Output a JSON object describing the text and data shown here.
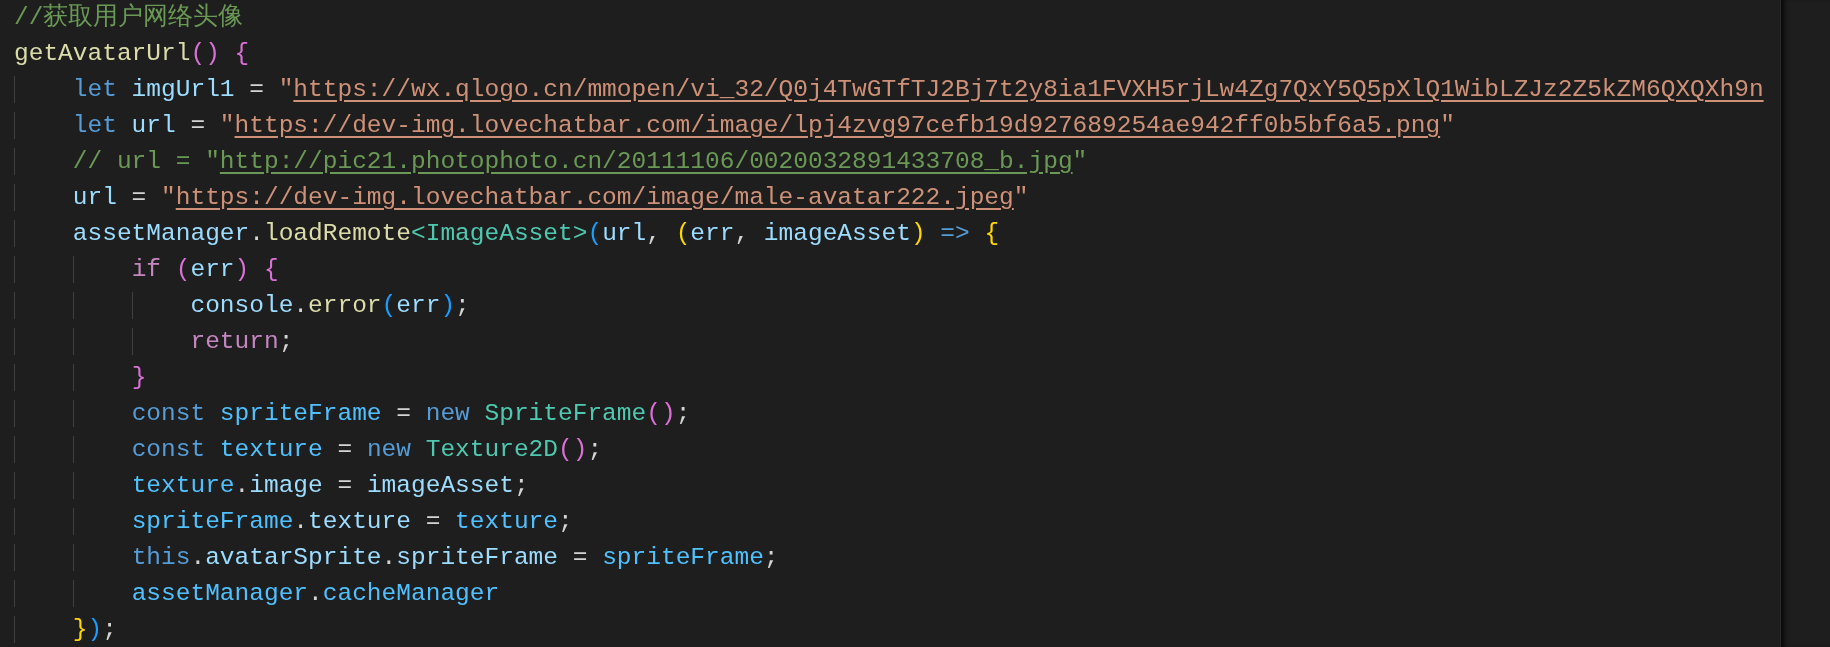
{
  "editor": {
    "lines": [
      {
        "tokens": [
          {
            "text": "//获取用户网络头像",
            "kind": "comment"
          }
        ]
      },
      {
        "tokens": [
          {
            "text": "getAvatarUrl",
            "kind": "function"
          },
          {
            "text": "()",
            "kind": "bracket2"
          },
          {
            "text": " {",
            "kind": "bracket2"
          }
        ]
      },
      {
        "tokens": [
          {
            "text": "    let",
            "kind": "keyword"
          },
          {
            "text": " imgUrl1",
            "kind": "variable"
          },
          {
            "text": " = ",
            "kind": "plain"
          },
          {
            "text": "\"",
            "kind": "string"
          },
          {
            "text": "https://wx.qlogo.cn/mmopen/vi_32/Q0j4TwGTfTJ2Bj7t2y8ia1FVXH5rjLw4Zg7QxY5Q5pXlQ1WibLZJz2Z5kZM6QXQXh9n",
            "kind": "string_link"
          }
        ]
      },
      {
        "tokens": [
          {
            "text": "    let",
            "kind": "keyword"
          },
          {
            "text": " url",
            "kind": "variable"
          },
          {
            "text": " = ",
            "kind": "plain"
          },
          {
            "text": "\"",
            "kind": "string"
          },
          {
            "text": "https://dev-img.lovechatbar.com/image/lpj4zvg97cefb19d927689254ae942ff0b5bf6a5.png",
            "kind": "string_link"
          },
          {
            "text": "\"",
            "kind": "string"
          }
        ]
      },
      {
        "tokens": [
          {
            "text": "    // url = \"",
            "kind": "comment"
          },
          {
            "text": "http://pic21.photophoto.cn/20111106/0020032891433708_b.jpg",
            "kind": "comment_link"
          },
          {
            "text": "\"",
            "kind": "comment"
          }
        ]
      },
      {
        "tokens": [
          {
            "text": "    url",
            "kind": "variable"
          },
          {
            "text": " = ",
            "kind": "plain"
          },
          {
            "text": "\"",
            "kind": "string"
          },
          {
            "text": "https://dev-img.lovechatbar.com/image/male-avatar222.jpeg",
            "kind": "string_link"
          },
          {
            "text": "\"",
            "kind": "string"
          }
        ]
      },
      {
        "tokens": [
          {
            "text": "    assetManager",
            "kind": "variable"
          },
          {
            "text": ".",
            "kind": "plain"
          },
          {
            "text": "loadRemote",
            "kind": "function"
          },
          {
            "text": "<ImageAsset>",
            "kind": "type"
          },
          {
            "text": "(",
            "kind": "bracket3"
          },
          {
            "text": "url",
            "kind": "variable"
          },
          {
            "text": ", ",
            "kind": "plain"
          },
          {
            "text": "(",
            "kind": "bracket1"
          },
          {
            "text": "err",
            "kind": "variable"
          },
          {
            "text": ", ",
            "kind": "plain"
          },
          {
            "text": "imageAsset",
            "kind": "variable"
          },
          {
            "text": ")",
            "kind": "bracket1"
          },
          {
            "text": " =>",
            "kind": "keyword"
          },
          {
            "text": " {",
            "kind": "bracket1"
          }
        ]
      },
      {
        "tokens": [
          {
            "text": "        if",
            "kind": "control"
          },
          {
            "text": " (",
            "kind": "bracket2"
          },
          {
            "text": "err",
            "kind": "variable"
          },
          {
            "text": ")",
            "kind": "bracket2"
          },
          {
            "text": " {",
            "kind": "bracket2"
          }
        ]
      },
      {
        "tokens": [
          {
            "text": "            console",
            "kind": "variable"
          },
          {
            "text": ".",
            "kind": "plain"
          },
          {
            "text": "error",
            "kind": "function"
          },
          {
            "text": "(",
            "kind": "bracket3"
          },
          {
            "text": "err",
            "kind": "variable"
          },
          {
            "text": ")",
            "kind": "bracket3"
          },
          {
            "text": ";",
            "kind": "plain"
          }
        ]
      },
      {
        "tokens": [
          {
            "text": "            return",
            "kind": "control"
          },
          {
            "text": ";",
            "kind": "plain"
          }
        ]
      },
      {
        "tokens": [
          {
            "text": "        }",
            "kind": "bracket2"
          }
        ]
      },
      {
        "tokens": [
          {
            "text": "        const",
            "kind": "keyword"
          },
          {
            "text": " spriteFrame",
            "kind": "constant"
          },
          {
            "text": " = ",
            "kind": "plain"
          },
          {
            "text": "new",
            "kind": "keyword"
          },
          {
            "text": " SpriteFrame",
            "kind": "type"
          },
          {
            "text": "()",
            "kind": "bracket2"
          },
          {
            "text": ";",
            "kind": "plain"
          }
        ]
      },
      {
        "tokens": [
          {
            "text": "        const",
            "kind": "keyword"
          },
          {
            "text": " texture",
            "kind": "constant"
          },
          {
            "text": " = ",
            "kind": "plain"
          },
          {
            "text": "new",
            "kind": "keyword"
          },
          {
            "text": " Texture2D",
            "kind": "type"
          },
          {
            "text": "()",
            "kind": "bracket2"
          },
          {
            "text": ";",
            "kind": "plain"
          }
        ]
      },
      {
        "tokens": [
          {
            "text": "        texture",
            "kind": "constant"
          },
          {
            "text": ".",
            "kind": "plain"
          },
          {
            "text": "image",
            "kind": "variable"
          },
          {
            "text": " = ",
            "kind": "plain"
          },
          {
            "text": "imageAsset",
            "kind": "variable"
          },
          {
            "text": ";",
            "kind": "plain"
          }
        ]
      },
      {
        "tokens": [
          {
            "text": "        spriteFrame",
            "kind": "constant"
          },
          {
            "text": ".",
            "kind": "plain"
          },
          {
            "text": "texture",
            "kind": "variable"
          },
          {
            "text": " = ",
            "kind": "plain"
          },
          {
            "text": "texture",
            "kind": "constant"
          },
          {
            "text": ";",
            "kind": "plain"
          }
        ]
      },
      {
        "tokens": [
          {
            "text": "        this",
            "kind": "keyword"
          },
          {
            "text": ".",
            "kind": "plain"
          },
          {
            "text": "avatarSprite",
            "kind": "variable"
          },
          {
            "text": ".",
            "kind": "plain"
          },
          {
            "text": "spriteFrame",
            "kind": "variable"
          },
          {
            "text": " = ",
            "kind": "plain"
          },
          {
            "text": "spriteFrame",
            "kind": "constant"
          },
          {
            "text": ";",
            "kind": "plain"
          }
        ]
      },
      {
        "tokens": [
          {
            "text": "        assetManager",
            "kind": "constant"
          },
          {
            "text": ".",
            "kind": "plain"
          },
          {
            "text": "cacheManager",
            "kind": "constant"
          }
        ]
      },
      {
        "tokens": [
          {
            "text": "    }",
            "kind": "bracket1"
          },
          {
            "text": ")",
            "kind": "bracket3"
          },
          {
            "text": ";",
            "kind": "plain"
          }
        ]
      }
    ]
  }
}
